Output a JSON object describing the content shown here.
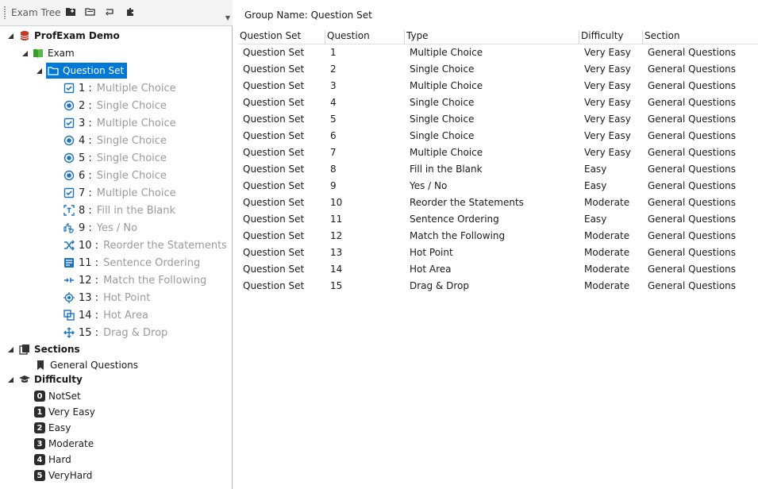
{
  "toolbar": {
    "title": "Exam Tree",
    "buttons": [
      "new-group-icon",
      "open-folder-icon",
      "refresh-icon",
      "plugin-icon"
    ]
  },
  "tree": {
    "root": {
      "label": "ProfExam Demo",
      "icon": "database-icon"
    },
    "exam": {
      "label": "Exam",
      "icon": "book-icon"
    },
    "question_set": {
      "label": "Question Set",
      "icon": "folder-icon"
    },
    "questions": [
      {
        "num": "1 :",
        "label": "Multiple Choice",
        "icon": "checkbox-icon"
      },
      {
        "num": "2 :",
        "label": "Single Choice",
        "icon": "radio-icon"
      },
      {
        "num": "3 :",
        "label": "Multiple Choice",
        "icon": "checkbox-icon"
      },
      {
        "num": "4 :",
        "label": "Single Choice",
        "icon": "radio-icon"
      },
      {
        "num": "5 :",
        "label": "Single Choice",
        "icon": "radio-icon"
      },
      {
        "num": "6 :",
        "label": "Single Choice",
        "icon": "radio-icon"
      },
      {
        "num": "7 :",
        "label": "Multiple Choice",
        "icon": "checkbox-icon"
      },
      {
        "num": "8 :",
        "label": "Fill in the Blank",
        "icon": "fill-blank-icon"
      },
      {
        "num": "9 :",
        "label": "Yes / No",
        "icon": "thumbs-icon"
      },
      {
        "num": "10 :",
        "label": "Reorder the Statements",
        "icon": "shuffle-icon"
      },
      {
        "num": "11 :",
        "label": "Sentence Ordering",
        "icon": "sentence-icon"
      },
      {
        "num": "12 :",
        "label": "Match the Following",
        "icon": "match-icon"
      },
      {
        "num": "13 :",
        "label": "Hot Point",
        "icon": "target-icon"
      },
      {
        "num": "14 :",
        "label": "Hot Area",
        "icon": "hot-area-icon"
      },
      {
        "num": "15 :",
        "label": "Drag & Drop",
        "icon": "move-icon"
      }
    ],
    "sections": {
      "label": "Sections",
      "icon": "sections-icon",
      "items": [
        "General Questions"
      ]
    },
    "difficulty": {
      "label": "Difficulty",
      "icon": "graduation-cap-icon",
      "items": [
        {
          "badge": "0",
          "label": "NotSet"
        },
        {
          "badge": "1",
          "label": "Very Easy"
        },
        {
          "badge": "2",
          "label": "Easy"
        },
        {
          "badge": "3",
          "label": "Moderate"
        },
        {
          "badge": "4",
          "label": "Hard"
        },
        {
          "badge": "5",
          "label": "VeryHard"
        }
      ]
    }
  },
  "content": {
    "group_name": "Group Name: Question Set",
    "columns": [
      "Question Set",
      "Question",
      "Type",
      "Difficulty",
      "Section"
    ],
    "rows": [
      [
        "Question Set",
        "1",
        "Multiple Choice",
        "Very Easy",
        "General Questions"
      ],
      [
        "Question Set",
        "2",
        "Single Choice",
        "Very Easy",
        "General Questions"
      ],
      [
        "Question Set",
        "3",
        "Multiple Choice",
        "Very Easy",
        "General Questions"
      ],
      [
        "Question Set",
        "4",
        "Single Choice",
        "Very Easy",
        "General Questions"
      ],
      [
        "Question Set",
        "5",
        "Single Choice",
        "Very Easy",
        "General Questions"
      ],
      [
        "Question Set",
        "6",
        "Single Choice",
        "Very Easy",
        "General Questions"
      ],
      [
        "Question Set",
        "7",
        "Multiple Choice",
        "Very Easy",
        "General Questions"
      ],
      [
        "Question Set",
        "8",
        "Fill in the Blank",
        "Easy",
        "General Questions"
      ],
      [
        "Question Set",
        "9",
        "Yes / No",
        "Easy",
        "General Questions"
      ],
      [
        "Question Set",
        "10",
        "Reorder the Statements",
        "Moderate",
        "General Questions"
      ],
      [
        "Question Set",
        "11",
        "Sentence Ordering",
        "Easy",
        "General Questions"
      ],
      [
        "Question Set",
        "12",
        "Match the Following",
        "Moderate",
        "General Questions"
      ],
      [
        "Question Set",
        "13",
        "Hot Point",
        "Moderate",
        "General Questions"
      ],
      [
        "Question Set",
        "14",
        "Hot Area",
        "Moderate",
        "General Questions"
      ],
      [
        "Question Set",
        "15",
        "Drag & Drop",
        "Moderate",
        "General Questions"
      ]
    ]
  },
  "colors": {
    "selection": "#0078d7",
    "icon_blue": "#1e73be",
    "db_red": "#c0392b",
    "book_green": "#3a9a2f"
  }
}
